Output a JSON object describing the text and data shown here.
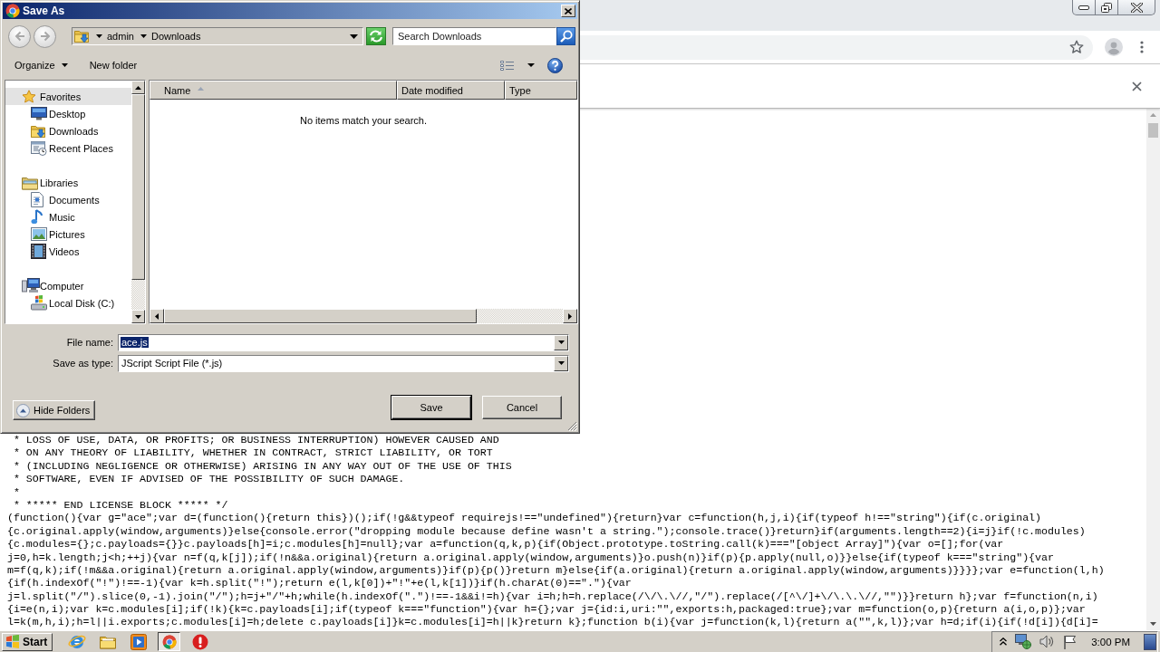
{
  "dialog": {
    "title": "Save As",
    "back": {
      "disabled": true
    },
    "forward": {
      "disabled": true
    },
    "breadcrumbs": [
      "admin",
      "Downloads"
    ],
    "search": {
      "placeholder": "Search Downloads"
    },
    "toolbar": {
      "organize": "Organize",
      "new_folder": "New folder"
    },
    "nav_tree": [
      {
        "label": "Favorites",
        "kind": "favorites",
        "selected": true,
        "children": [
          {
            "label": "Desktop",
            "kind": "desktop",
            "selected": false
          },
          {
            "label": "Downloads",
            "kind": "downloads",
            "selected": false
          },
          {
            "label": "Recent Places",
            "kind": "recent",
            "selected": false
          }
        ]
      },
      {
        "label": "Libraries",
        "kind": "libraries",
        "selected": false,
        "children": [
          {
            "label": "Documents",
            "kind": "documents",
            "selected": false
          },
          {
            "label": "Music",
            "kind": "music",
            "selected": false
          },
          {
            "label": "Pictures",
            "kind": "pictures",
            "selected": false
          },
          {
            "label": "Videos",
            "kind": "videos",
            "selected": false
          }
        ]
      },
      {
        "label": "Computer",
        "kind": "computer",
        "selected": false,
        "children": [
          {
            "label": "Local Disk (C:)",
            "kind": "drive",
            "selected": false
          }
        ]
      }
    ],
    "columns": [
      {
        "label": "Name",
        "sorted": true
      },
      {
        "label": "Date modified",
        "sorted": false
      },
      {
        "label": "Type",
        "sorted": false
      }
    ],
    "empty_message": "No items match your search.",
    "file_name": {
      "label": "File name:",
      "value": "ace.js",
      "text_selected": true
    },
    "save_as_type": {
      "label": "Save as type:",
      "value": "JScript Script File (*.js)"
    },
    "hide_folders": "Hide Folders",
    "buttons": [
      {
        "label": "Save",
        "default": true
      },
      {
        "label": "Cancel",
        "default": false
      }
    ]
  },
  "browser": {
    "code_lines": [
      " * LOSS OF USE, DATA, OR PROFITS; OR BUSINESS INTERRUPTION) HOWEVER CAUSED AND",
      " * ON ANY THEORY OF LIABILITY, WHETHER IN CONTRACT, STRICT LIABILITY, OR TORT",
      " * (INCLUDING NEGLIGENCE OR OTHERWISE) ARISING IN ANY WAY OUT OF THE USE OF THIS",
      " * SOFTWARE, EVEN IF ADVISED OF THE POSSIBILITY OF SUCH DAMAGE.",
      " *",
      " * ***** END LICENSE BLOCK ***** */",
      "(function(){var g=\"ace\";var d=(function(){return this})();if(!g&&typeof requirejs!==\"undefined\"){return}var c=function(h,j,i){if(typeof h!==\"string\"){if(c.original)",
      "{c.original.apply(window,arguments)}else{console.error(\"dropping module because define wasn't a string.\");console.trace()}return}if(arguments.length==2){i=j}if(!c.modules)",
      "{c.modules={};c.payloads={}}c.payloads[h]=i;c.modules[h]=null};var a=function(q,k,p){if(Object.prototype.toString.call(k)===\"[object Array]\"){var o=[];for(var",
      "j=0,h=k.length;j<h;++j){var n=f(q,k[j]);if(!n&&a.original){return a.original.apply(window,arguments)}o.push(n)}if(p){p.apply(null,o)}}else{if(typeof k===\"string\"){var",
      "m=f(q,k);if(!m&&a.original){return a.original.apply(window,arguments)}if(p){p()}return m}else{if(a.original){return a.original.apply(window,arguments)}}}};var e=function(l,h)",
      "{if(h.indexOf(\"!\")!==-1){var k=h.split(\"!\");return e(l,k[0])+\"!\"+e(l,k[1])}if(h.charAt(0)==\".\"){var",
      "j=l.split(\"/\").slice(0,-1).join(\"/\");h=j+\"/\"+h;while(h.indexOf(\".\")!==-1&&i!=h){var i=h;h=h.replace(/\\/\\.\\//,\"/\").replace(/[^\\/]+\\/\\.\\.\\//,\"\")}}return h};var f=function(n,i)",
      "{i=e(n,i);var k=c.modules[i];if(!k){k=c.payloads[i];if(typeof k===\"function\"){var h={};var j={id:i,uri:\"\",exports:h,packaged:true};var m=function(o,p){return a(i,o,p)};var",
      "l=k(m,h,i);h=l||i.exports;c.modules[i]=h;delete c.payloads[i]}k=c.modules[i]=h||k}return k};function b(i){var j=function(k,l){return a(\"\",k,l)};var h=d;if(i){if(!d[i]){d[i]="
    ]
  },
  "taskbar": {
    "start": "Start",
    "apps": [
      {
        "kind": "internet",
        "selected": false
      },
      {
        "kind": "files",
        "selected": false
      },
      {
        "kind": "media",
        "selected": false
      },
      {
        "kind": "browser",
        "selected": true
      },
      {
        "kind": "security",
        "selected": false
      }
    ],
    "clock": "3:00 PM"
  }
}
